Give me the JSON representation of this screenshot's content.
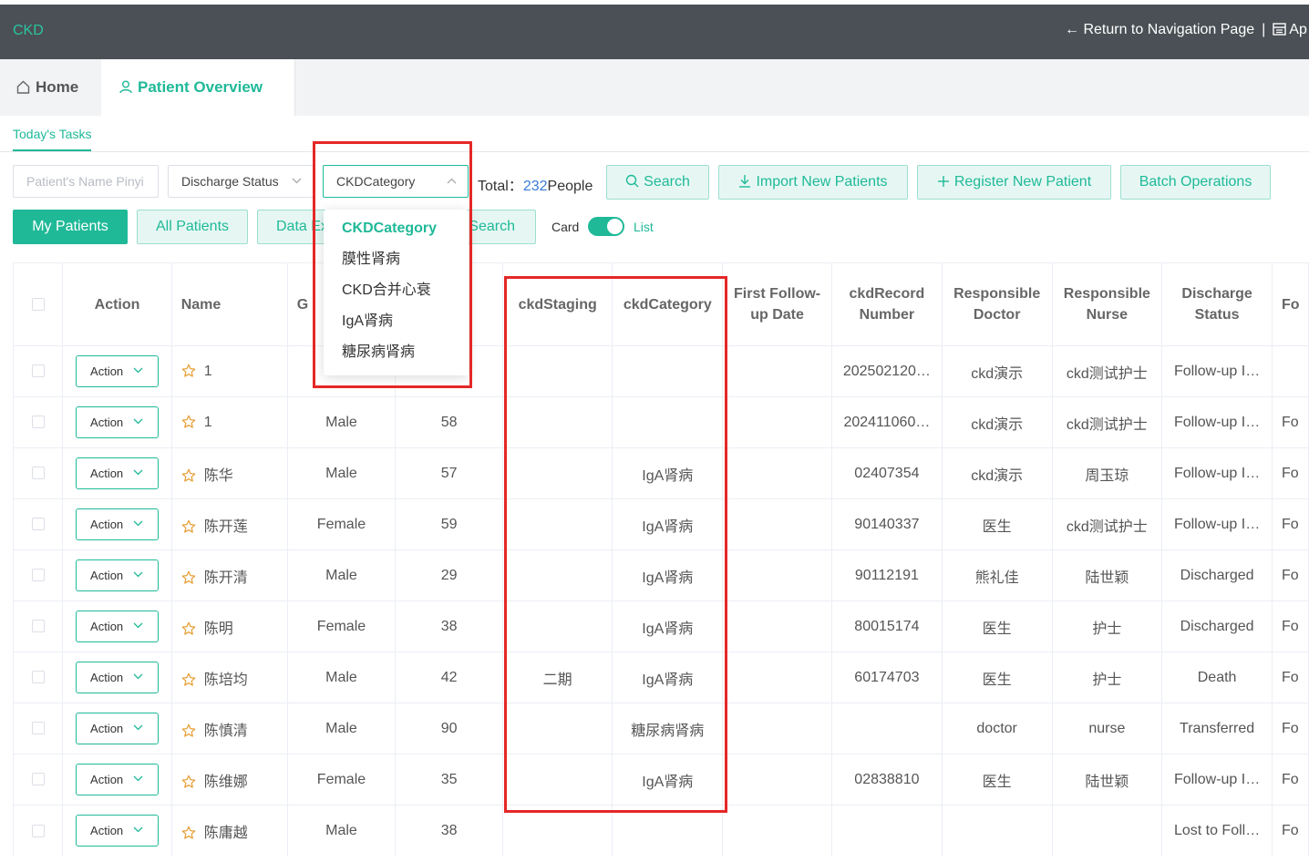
{
  "topbar": {
    "brand": "CKD",
    "return_link": "← Return to Navigation Page",
    "separator": "|",
    "app_link": "Ap"
  },
  "tabs": {
    "home": "Home",
    "patient_overview": "Patient Overview"
  },
  "subtab": "Today's Tasks",
  "filters": {
    "name_placeholder": "Patient's Name Pinyi",
    "discharge_status": "Discharge Status",
    "ckd_category": "CKDCategory"
  },
  "total": {
    "label": "Total：",
    "count": "232",
    "unit": "People"
  },
  "buttons": {
    "search": "Search",
    "import": "Import New Patients",
    "register": "Register New Patient",
    "batch": "Batch Operations",
    "my_patients": "My Patients",
    "all_patients": "All Patients",
    "data_export": "Data Ex",
    "advanced_search": "Search"
  },
  "view_toggle": {
    "card": "Card",
    "list": "List"
  },
  "dropdown": {
    "options": [
      "CKDCategory",
      "膜性肾病",
      "CKD合并心衰",
      "IgA肾病",
      "糖尿病肾病"
    ],
    "selected": "CKDCategory"
  },
  "table": {
    "headers": [
      "",
      "Action",
      "Name",
      "G",
      "",
      "ckdStaging",
      "ckdCategory",
      "First Follow-up Date",
      "ckdRecord Number",
      "Responsible Doctor",
      "Responsible Nurse",
      "Discharge Status",
      "Fo"
    ],
    "action_label": "Action",
    "rows": [
      {
        "name": "1",
        "gender": "",
        "age": "",
        "staging": "",
        "category": "",
        "followup": "",
        "record": "202502120…",
        "doctor": "ckd演示",
        "nurse": "ckd测试护士",
        "status": "Follow-up I…",
        "fo": ""
      },
      {
        "name": "1",
        "gender": "Male",
        "age": "58",
        "staging": "",
        "category": "",
        "followup": "",
        "record": "202411060…",
        "doctor": "ckd演示",
        "nurse": "ckd测试护士",
        "status": "Follow-up I…",
        "fo": "Fo"
      },
      {
        "name": "陈华",
        "gender": "Male",
        "age": "57",
        "staging": "",
        "category": "IgA肾病",
        "followup": "",
        "record": "02407354",
        "doctor": "ckd演示",
        "nurse": "周玉琼",
        "status": "Follow-up I…",
        "fo": "Fo"
      },
      {
        "name": "陈开莲",
        "gender": "Female",
        "age": "59",
        "staging": "",
        "category": "IgA肾病",
        "followup": "",
        "record": "90140337",
        "doctor": "医生",
        "nurse": "ckd测试护士",
        "status": "Follow-up I…",
        "fo": "Fo"
      },
      {
        "name": "陈开清",
        "gender": "Male",
        "age": "29",
        "staging": "",
        "category": "IgA肾病",
        "followup": "",
        "record": "90112191",
        "doctor": "熊礼佳",
        "nurse": "陆世颖",
        "status": "Discharged",
        "fo": "Fo"
      },
      {
        "name": "陈明",
        "gender": "Female",
        "age": "38",
        "staging": "",
        "category": "IgA肾病",
        "followup": "",
        "record": "80015174",
        "doctor": "医生",
        "nurse": "护士",
        "status": "Discharged",
        "fo": "Fo"
      },
      {
        "name": "陈培均",
        "gender": "Male",
        "age": "42",
        "staging": "二期",
        "category": "IgA肾病",
        "followup": "",
        "record": "60174703",
        "doctor": "医生",
        "nurse": "护士",
        "status": "Death",
        "fo": "Fo"
      },
      {
        "name": "陈慎清",
        "gender": "Male",
        "age": "90",
        "staging": "",
        "category": "糖尿病肾病",
        "followup": "",
        "record": "",
        "doctor": "doctor",
        "nurse": "nurse",
        "status": "Transferred",
        "fo": "Fo"
      },
      {
        "name": "陈维娜",
        "gender": "Female",
        "age": "35",
        "staging": "",
        "category": "IgA肾病",
        "followup": "",
        "record": "02838810",
        "doctor": "医生",
        "nurse": "陆世颖",
        "status": "Follow-up I…",
        "fo": "Fo"
      },
      {
        "name": "陈庸越",
        "gender": "Male",
        "age": "38",
        "staging": "",
        "category": "",
        "followup": "",
        "record": "",
        "doctor": "",
        "nurse": "",
        "status": "Lost to Foll…",
        "fo": "Fo"
      }
    ]
  },
  "colors": {
    "accent": "#1fb998",
    "topbar": "#4a5055",
    "highlight_box": "#e52727"
  }
}
